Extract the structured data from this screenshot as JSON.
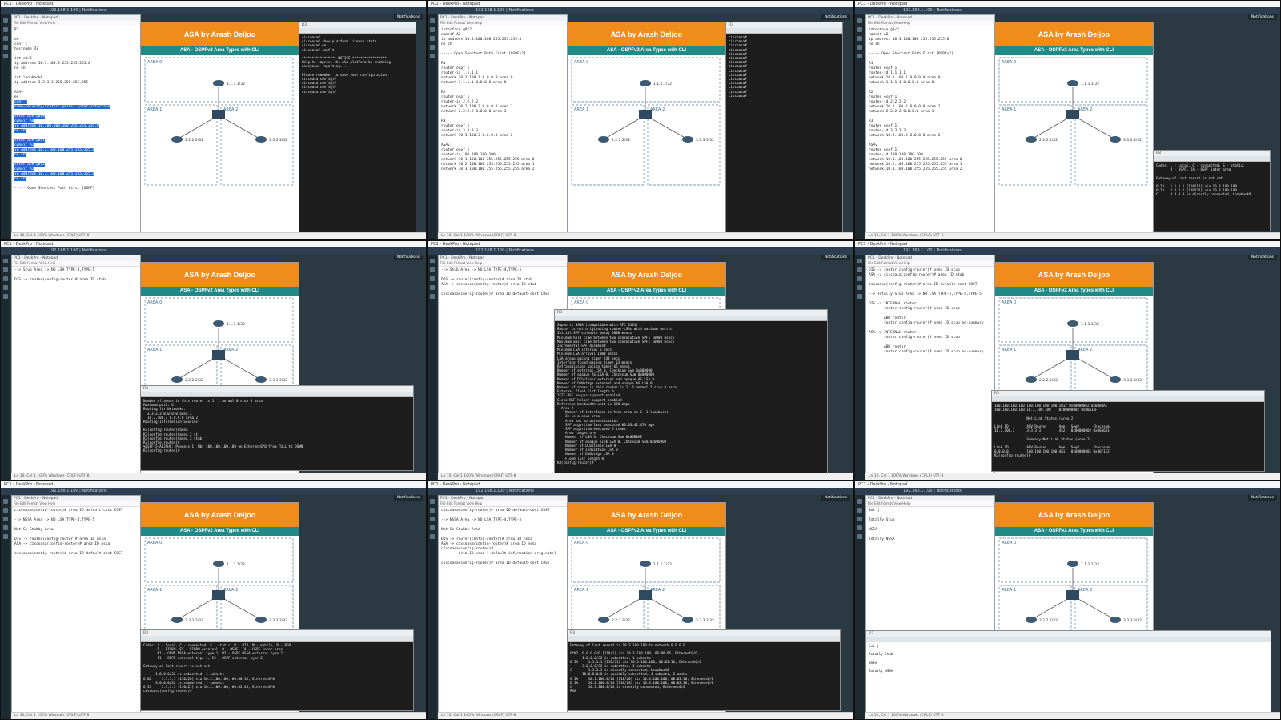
{
  "window_title": "PC1 - DeskPro - Notepad",
  "browser_tab": "192.168.1.100 | Notifications",
  "notifications_label": "Notifications",
  "slide": {
    "banner": "ASA by Arash Deljoo",
    "subtitle": "ASA - OSPFv2 Area Types with CLI",
    "areas": [
      "AREA 0",
      "AREA 1",
      "AREA 2"
    ],
    "router_labels": [
      "1.1.1.1/32",
      "2.2.2.2/32",
      "3.3.3.3/32"
    ]
  },
  "status_text": "Ln 10, Col 1   100%   Windows (CRLF)   UTF-8",
  "colors": {
    "banner": "#f08c1c",
    "subtitle": "#1f8a86",
    "terminal": "#1d1d1d"
  },
  "tiles": [
    {
      "notepad_lines": [
        "R3",
        "",
        "en",
        "conf t",
        "hostname R3",
        "",
        "int e0/0",
        "ip address 10.3.100.3 255.255.255.0",
        "no sh",
        "",
        "int loopback0",
        "ip address 3.3.3.3 255.255.255.255",
        "",
        "ASAv",
        "en",
        "conf t",
        "same-security-traffic permit inter-interface",
        "",
        "interface g0/0",
        "nameif A0",
        "ip address 10.100.100.100 255.255.255.0",
        "no sh",
        "",
        "interface g0/1",
        "nameif A1",
        "ip address 10.2.100.100 255.255.255.0",
        "no sh",
        "",
        "interface g0/2",
        "nameif A2",
        "ip address 10.3.100.100 255.255.255.0",
        "no sh",
        "",
        "----- Open Shortest Path First [OSPF]"
      ],
      "terminal_lines": [
        "ciscoasa#",
        "ciscoasa# show platform license state",
        "ciscoasa# en",
        "ciscoasa# conf t",
        "",
        "***************** NOTICE *****************",
        "Help to improve the ASA platform by enabling",
        "anonymous reporting...",
        "",
        "Please remember to save your configuration.",
        "ciscoasa(config)#",
        "ciscoasa(config)#",
        "ciscoasa(config)#",
        "ciscoasa(config)#"
      ]
    },
    {
      "notepad_lines": [
        "interface g0/2",
        "nameif A2",
        "ip address 10.3.100.100 255.255.255.0",
        "no sh",
        "",
        "----- Open Shortest Path First [OSPFv2]",
        "",
        "R1",
        "router ospf 1",
        "router-id 1.1.1.1",
        "network 10.1.100.1 0.0.0.0 area 0",
        "network 1.1.1.1 0.0.0.0 area 0",
        "",
        "R2",
        "router ospf 1",
        "router-id 2.2.2.2",
        "network 10.2.100.2 0.0.0.0 area 1",
        "network 2.2.2.2 0.0.0.0 area 1",
        "",
        "R3",
        "router ospf 1",
        "router-id 3.3.3.3",
        "network 10.3.100.3 0.0.0.0 area 2",
        "",
        "ASAv",
        "router ospf 1",
        "router-id 100.100.100.100",
        "network 10.1.100.100 255.255.255.255 area 0",
        "network 10.2.100.100 255.255.255.255 area 1",
        "network 10.3.100.100 255.255.255.255 area 2"
      ],
      "terminal_lines": [
        "ciscoasa#",
        "ciscoasa#",
        "ciscoasa#",
        "ciscoasa#",
        "ciscoasa#",
        "ciscoasa#",
        "ciscoasa#",
        "ciscoasa#",
        "ciscoasa#",
        "ciscoasa#",
        "ciscoasa#",
        "ciscoasa#",
        "ciscoasa#",
        "ciscoasa#",
        "ciscoasa#"
      ]
    },
    {
      "notepad_lines": [
        "interface g0/2",
        "nameif A2",
        "ip address 10.3.100.100 255.255.255.0",
        "no sh",
        "",
        "----- Open Shortest Path First [OSPFv2]",
        "",
        "R1",
        "router ospf 1",
        "router-id 1.1.1.1",
        "network 10.1.100.1 0.0.0.0 area 0",
        "network 1.1.1.1 0.0.0.0 area 0",
        "",
        "R2",
        "router ospf 1",
        "router-id 2.2.2.2",
        "network 10.2.100.2 0.0.0.0 area 1",
        "network 2.2.2.2 0.0.0.0 area 1",
        "",
        "R3",
        "router ospf 1",
        "router-id 3.3.3.3",
        "network 10.3.100.3 0.0.0.0 area 2",
        "",
        "ASAv",
        "router ospf 1",
        "router-id 100.100.100.100",
        "network 10.1.100.100 255.255.255.255 area 0",
        "network 10.2.100.100 255.255.255.255 area 1",
        "network 10.3.100.100 255.255.255.255 area 2"
      ],
      "terminal_lines": [
        "Codes: L - local, C - connected, S - static,",
        "       O - OSPF, IA - OSPF inter area",
        "",
        "Gateway of last resort is not set",
        "",
        "O IA   1.1.1.1 [110/11] via 10.3.100.100",
        "O IA   2.2.2.2 [110/21] via 10.3.100.100",
        "C      3.3.3.3 is directly connected, Loopback0"
      ]
    },
    {
      "notepad_lines": [
        "--> Stub Area -> NO LSA TYPE-4,TYPE-5",
        "",
        "DIS -> router(config-router)# area ID stub"
      ],
      "terminal_lines": [
        "Number of areas in this router is 1. 1 normal 0 stub 0 nssa",
        "Maximum path: 4",
        "Routing for Networks:",
        "  3.3.3.3 0.0.0.0 area 2",
        "  10.3.100.3 0.0.0.0 area 2",
        "Routing Information Sources:",
        "",
        "R3(config-router)#area",
        "R3(config-router)#area 2 st",
        "R3(config-router)#area 2 stub",
        "R3(config-router)#",
        "%OSPF-5-ADJCHG: Process 1, Nbr 100.100.100.100 on Ethernet0/0 from FULL to DOWN",
        "R3(config-router)#"
      ]
    },
    {
      "notepad_lines": [
        "--> Stub Area -> NO LSA TYPE-4,TYPE-5",
        "",
        "DIS -> router(config-router)# area ID stub",
        "ASA -> ciscoasa(config-router)# area ID stub",
        "",
        "ciscoasa(config-router)# area ID default-cost COST"
      ],
      "terminal_lines": [
        "Supports NSSA (compatible with RFC 3101)",
        "Router is not originating router-LSAs with maximum metric",
        "Initial SPF schedule delay 5000 msecs",
        "Minimum hold time between two consecutive SPFs 10000 msecs",
        "Maximum wait time between two consecutive SPFs 10000 msecs",
        "Incremental-SPF disabled",
        "Minimum LSA interval 5 secs",
        "Minimum LSA arrival 1000 msecs",
        "LSA group pacing timer 240 secs",
        "Interface flood pacing timer 33 msecs",
        "Retransmission pacing timer 66 msecs",
        "Number of external LSA 0. Checksum Sum 0x000000",
        "Number of opaque AS LSA 0. Checksum Sum 0x000000",
        "Number of DCbitless external and opaque AS LSA 0",
        "Number of DoNotAge external and opaque AS LSA 0",
        "Number of areas in this router is 1. 0 normal 1 stub 0 nssa",
        "External flood list length 0",
        "IETF NSF helper support enabled",
        "Cisco NSF helper support enabled",
        "Reference bandwidth unit is 100 mbps",
        "  Area 2",
        "    Number of interfaces in this area is 2 (1 loopback)",
        "    It is a stub area",
        "    Area has no authentication",
        "    SPF algorithm last executed 00:03:42.476 ago",
        "    SPF algorithm executed 5 times",
        "    Area ranges are",
        "    Number of LSA 3. Checksum Sum 0x00B0AE",
        "    Number of opaque link LSA 0. Checksum Sum 0x000000",
        "    Number of DCbitless LSA 0",
        "    Number of indication LSA 0",
        "    Number of DoNotAge LSA 0",
        "    Flood list length 0",
        "R3(config-router)#"
      ]
    },
    {
      "notepad_lines": [
        "DIS -> router(config-router)# area ID stub",
        "ASA -> ciscoasa(config-router)# area ID stub",
        "",
        "ciscoasa(config-router)# area ID default-cost COST",
        "",
        "--> Totally Stub Area -> NO LSA TYPE-3,TYPE-4,TYPE-5",
        "",
        "DIS -> INTERNAL router",
        "       router(config-router)# area ID stub",
        "",
        "       ABR router",
        "       router(config-router)# area ID stub no-summary",
        "",
        "ASA -> INTERNAL router",
        "       router(config-router)# area ID stub",
        "",
        "       ABR router",
        "       router(config-router)# area ID stub no-summary"
      ],
      "terminal_lines": [
        "100.100.100.100 100.100.100.100 1012 0x80000002 0x00B0AE",
        "100.100.100.100 10.3.100.100    0x80000002 0x00A15F",
        "",
        "                Net Link States (Area 2)",
        "",
        "Link ID         ADV Router      Age   Seq#       Checksum",
        "10.3.100.3      3.3.3.3         452   0x80000002 0x0056A1",
        "",
        "                Summary Net Link States (Area 2)",
        "",
        "Link ID         ADV Router      Age   Seq#       Checksum",
        "0.0.0.0         100.100.100.100 461   0x80000001 0x00F1E2",
        "R3(config-router)#"
      ]
    },
    {
      "notepad_lines": [
        "ciscoasa(config-router)# area ID default-cost COST",
        "",
        "--> NSSA Area -> NO LSA TYPE-4,TYPE-5",
        "",
        "Not-So-Stubby Area",
        "",
        "DIS -> router(config-router)# area ID nssa",
        "ASA -> ciscoasa(config-router)# area ID nssa",
        "",
        "ciscoasa(config-router)# area ID default-cost COST"
      ],
      "terminal_lines": [
        "Codes: L - local, C - connected, S - static, R - RIP, M - mobile, B - BGP",
        "       D - EIGRP, EX - EIGRP external, O - OSPF, IA - OSPF inter area",
        "       N1 - OSPF NSSA external type 1, N2 - OSPF NSSA external type 2",
        "       E1 - OSPF external type 1, E2 - OSPF external type 2",
        "",
        "Gateway of last resort is not set",
        "",
        "      1.0.0.0/32 is subnetted, 1 subnets",
        "O N2     1.1.1.1 [110/20] via 10.2.100.100, 00:00:10, Ethernet0/0",
        "      3.0.0.0/32 is subnetted, 1 subnets",
        "O IA     3.3.3.3 [110/21] via 10.2.100.100, 00:02:48, Ethernet0/0",
        "ciscoasa(config-router)#"
      ]
    },
    {
      "notepad_lines": [
        "ciscoasa(config-router)# area ID default-cost COST",
        "",
        "--> NSSA Area -> NO LSA TYPE-4,TYPE-5",
        "",
        "Not-So-Stubby Area",
        "",
        "DIS -> router(config-router)# area ID nssa",
        "ASA -> ciscoasa(config-router)# area ID nssa",
        "ciscoasa(config-router)#",
        "        area ID nssa [ default-information-originate]",
        "",
        "ciscoasa(config-router)# area ID default-cost COST"
      ],
      "terminal_lines": [
        "Gateway of last resort is 10.3.100.100 to network 0.0.0.0",
        "",
        "O*N2  0.0.0.0/0 [110/1] via 10.3.100.100, 00:00:05, Ethernet0/0",
        "      1.0.0.0/32 is subnetted, 1 subnets",
        "O IA     1.1.1.1 [110/21] via 10.3.100.100, 00:03:16, Ethernet0/0",
        "      3.0.0.0/32 is subnetted, 1 subnets",
        "C        3.3.3.3 is directly connected, Loopback0",
        "      10.0.0.0/8 is variably subnetted, 4 subnets, 2 masks",
        "O IA     10.1.100.0/24 [110/20] via 10.3.100.100, 00:03:16, Ethernet0/0",
        "O IA     10.2.100.0/24 [110/20] via 10.3.100.100, 00:03:16, Ethernet0/0",
        "C        10.3.100.0/24 is directly connected, Ethernet0/0",
        "R3#"
      ]
    },
    {
      "notepad_lines": [
        "Sul |",
        "",
        "Totally Stub",
        "",
        "NSSA",
        "",
        "Totally NSSA"
      ],
      "terminal_lines": []
    }
  ]
}
